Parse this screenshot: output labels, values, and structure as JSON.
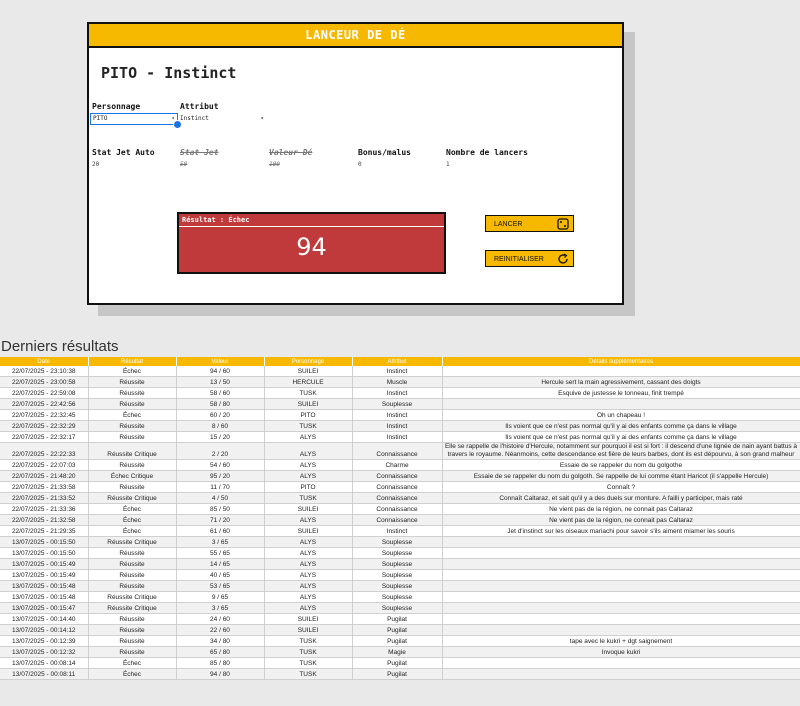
{
  "panel": {
    "header": "LANCEUR DE DÉ",
    "title": "PITO - Instinct",
    "personnage_label": "Personnage",
    "personnage_value": "PITO",
    "attribut_label": "Attribut",
    "attribut_value": "Instinct",
    "stat_auto_label": "Stat Jet Auto",
    "stat_auto_value": "20",
    "stat_jet_label": "Stat Jet",
    "stat_jet_value": "50",
    "valeur_de_label": "Valeur Dé",
    "valeur_de_value": "100",
    "bonus_label": "Bonus/malus",
    "bonus_value": "0",
    "lancers_label": "Nombre de lancers",
    "lancers_value": "1",
    "result_title": "Résultat : Échec",
    "result_value": "94",
    "lancer_button": "LANCER",
    "reset_button": "REINITIALISER",
    "accent": "#f7b800",
    "result_color": "#c0393b"
  },
  "history": {
    "title": "Derniers résultats",
    "columns": [
      "Date",
      "Résultat",
      "Valeur",
      "Personnage",
      "Attribut",
      "Détails supplémentaires"
    ],
    "rows": [
      [
        "22/07/2025 - 23:10:38",
        "Échec",
        "94 / 60",
        "SUILEI",
        "Instinct",
        ""
      ],
      [
        "22/07/2025 - 23:00:58",
        "Réussite",
        "13 / 50",
        "HERCULE",
        "Muscle",
        "Hercule sert la main agressivement, cassant des doigts"
      ],
      [
        "22/07/2025 - 22:59:08",
        "Réussite",
        "58 / 60",
        "TUSK",
        "Instinct",
        "Esquive de justesse le tonneau, finit trempé"
      ],
      [
        "22/07/2025 - 22:42:56",
        "Réussite",
        "58 / 80",
        "SUILEI",
        "Souplesse",
        ""
      ],
      [
        "22/07/2025 - 22:32:45",
        "Échec",
        "60 / 20",
        "PITO",
        "Instinct",
        "Oh un chapeau !"
      ],
      [
        "22/07/2025 - 22:32:29",
        "Réussite",
        "8 / 60",
        "TUSK",
        "Instinct",
        "Ils voient que ce n'est pas normal qu'il y ai des enfants comme ça dans le village"
      ],
      [
        "22/07/2025 - 22:32:17",
        "Réussite",
        "15 / 20",
        "ALYS",
        "Instinct",
        "Ils voient que ce n'est pas normal qu'il y ai des enfants comme ça dans le village"
      ],
      [
        "22/07/2025 - 22:22:33",
        "Réussite Critique",
        "2 / 20",
        "ALYS",
        "Connaissance",
        "Elle se rappelle de l'histoire d'Hercule, notamment sur pourquoi il est si fort : il descend d'une lignée de nain ayant battus à travers le royaume. Néanmoins, cette descendance est fière de leurs barbes, dont ils est dépourvu, à son grand malheur"
      ],
      [
        "22/07/2025 - 22:07:03",
        "Réussite",
        "54 / 60",
        "ALYS",
        "Charme",
        "Essaie de se rappeler du nom du golgothe"
      ],
      [
        "22/07/2025 - 21:48:20",
        "Échec Critique",
        "95 / 20",
        "ALYS",
        "Connaissance",
        "Essaie de se rappeler du nom du golgoth. Se rappelle de lui comme étant Haricot (il s'appelle Hercule)"
      ],
      [
        "22/07/2025 - 21:33:58",
        "Réussite",
        "11 / 70",
        "PITO",
        "Connaissance",
        "Connaît ?"
      ],
      [
        "22/07/2025 - 21:33:52",
        "Réussite Critique",
        "4 / 50",
        "TUSK",
        "Connaissance",
        "Connaît Caltaraz, et sait qu'il y a des duels sur monture. A failli y participer, mais raté"
      ],
      [
        "22/07/2025 - 21:33:36",
        "Échec",
        "85 / 50",
        "SUILEI",
        "Connaissance",
        "Ne vient pas de la région, ne connait pas Caltaraz"
      ],
      [
        "22/07/2025 - 21:32:58",
        "Échec",
        "71 / 20",
        "ALYS",
        "Connaissance",
        "Ne vient pas de la région, ne connait pas Caltaraz"
      ],
      [
        "22/07/2025 - 21:29:35",
        "Échec",
        "61 / 60",
        "SUILEI",
        "Instinct",
        "Jet d'instinct sur les oiseaux mariachi pour savoir s'ils aiment miamer les souris"
      ],
      [
        "13/07/2025 - 00:15:50",
        "Réussite Critique",
        "3 / 65",
        "ALYS",
        "Souplesse",
        ""
      ],
      [
        "13/07/2025 - 00:15:50",
        "Réussite",
        "55 / 65",
        "ALYS",
        "Souplesse",
        ""
      ],
      [
        "13/07/2025 - 00:15:49",
        "Réussite",
        "14 / 65",
        "ALYS",
        "Souplesse",
        ""
      ],
      [
        "13/07/2025 - 00:15:49",
        "Réussite",
        "40 / 65",
        "ALYS",
        "Souplesse",
        ""
      ],
      [
        "13/07/2025 - 00:15:48",
        "Réussite",
        "53 / 65",
        "ALYS",
        "Souplesse",
        ""
      ],
      [
        "13/07/2025 - 00:15:48",
        "Réussite Critique",
        "9 / 65",
        "ALYS",
        "Souplesse",
        ""
      ],
      [
        "13/07/2025 - 00:15:47",
        "Réussite Critique",
        "3 / 65",
        "ALYS",
        "Souplesse",
        ""
      ],
      [
        "13/07/2025 - 00:14:40",
        "Réussite",
        "24 / 60",
        "SUILEI",
        "Pugilat",
        ""
      ],
      [
        "13/07/2025 - 00:14:12",
        "Réussite",
        "22 / 60",
        "SUILEI",
        "Pugilat",
        ""
      ],
      [
        "13/07/2025 - 00:12:39",
        "Réussite",
        "34 / 80",
        "TUSK",
        "Pugilat",
        "tape avec le kukri + dgt saignement"
      ],
      [
        "13/07/2025 - 00:12:32",
        "Réussite",
        "65 / 80",
        "TUSK",
        "Magie",
        "Invoque kukri"
      ],
      [
        "13/07/2025 - 00:08:14",
        "Échec",
        "85 / 80",
        "TUSK",
        "Pugilat",
        ""
      ],
      [
        "13/07/2025 - 00:08:11",
        "Échec",
        "94 / 80",
        "TUSK",
        "Pugilat",
        ""
      ]
    ]
  }
}
